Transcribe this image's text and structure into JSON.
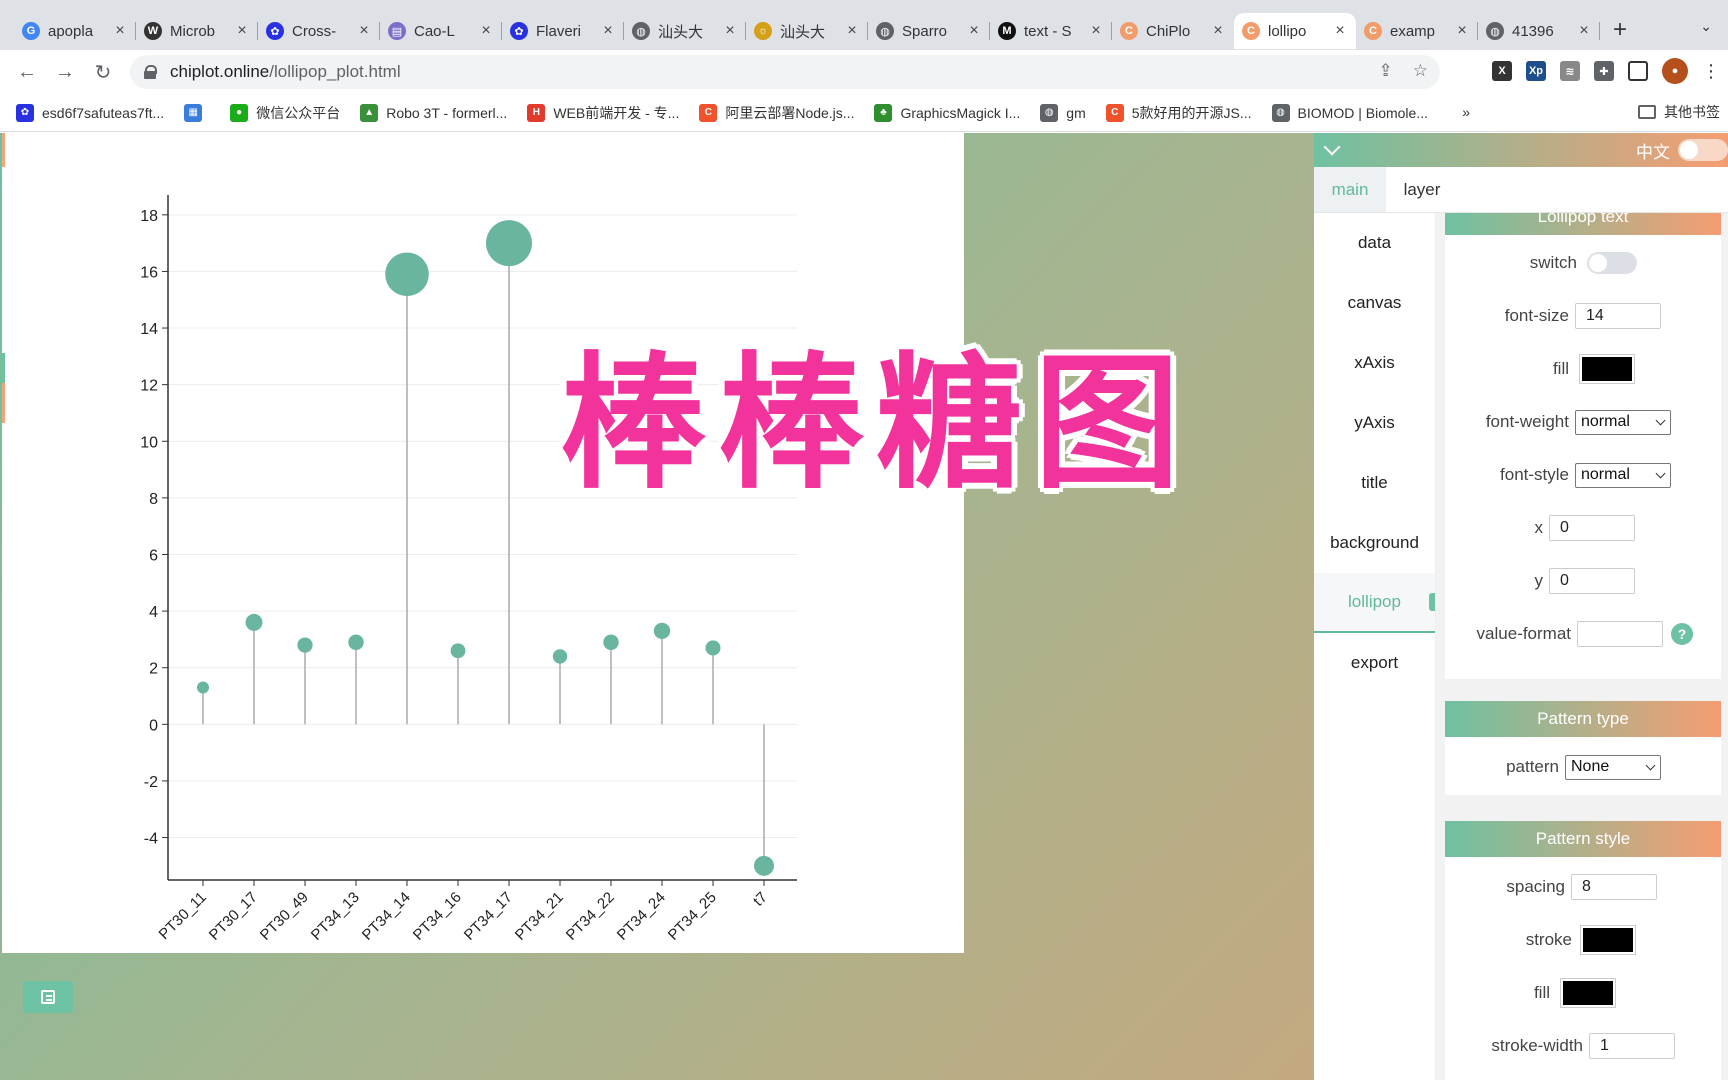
{
  "browser": {
    "tabs": [
      {
        "title": "apopla",
        "favicon": "google-icon",
        "color": "#4285f4",
        "glyph": "G"
      },
      {
        "title": "Microb",
        "favicon": "wikipedia-icon",
        "color": "#333333",
        "glyph": "W"
      },
      {
        "title": "Cross-",
        "favicon": "baidu-icon",
        "color": "#2932e1",
        "glyph": "✿"
      },
      {
        "title": "Cao-L",
        "favicon": "document-icon",
        "color": "#7a6fc9",
        "glyph": "▤"
      },
      {
        "title": "Flaveri",
        "favicon": "baidu-icon",
        "color": "#2932e1",
        "glyph": "✿"
      },
      {
        "title": "汕头大",
        "favicon": "globe-icon",
        "color": "#5f6368",
        "glyph": "◍"
      },
      {
        "title": "汕头大",
        "favicon": "university-icon",
        "color": "#d4a017",
        "glyph": "☼"
      },
      {
        "title": "Sparro",
        "favicon": "globe-icon",
        "color": "#5f6368",
        "glyph": "◍"
      },
      {
        "title": "text - S",
        "favicon": "m-icon",
        "color": "#111111",
        "glyph": "M"
      },
      {
        "title": "ChiPlo",
        "favicon": "chiplot-icon",
        "color": "#f39c6b",
        "glyph": "C"
      },
      {
        "title": "lollipo",
        "favicon": "chiplot-icon",
        "color": "#f39c6b",
        "glyph": "C"
      },
      {
        "title": "examp",
        "favicon": "chiplot-icon",
        "color": "#f39c6b",
        "glyph": "C"
      },
      {
        "title": "41396",
        "favicon": "globe-icon",
        "color": "#5f6368",
        "glyph": "◍"
      }
    ],
    "active_tab": 10,
    "url_host": "chiplot.online",
    "url_path": "/lollipop_plot.html",
    "bookmarks": [
      {
        "label": "esd6f7safuteas7ft...",
        "color": "#2932e1",
        "glyph": "✿"
      },
      {
        "label": "",
        "color": "#3b7ddd",
        "glyph": "▦"
      },
      {
        "label": "微信公众平台",
        "color": "#1aad19",
        "glyph": "●"
      },
      {
        "label": "Robo 3T - formerl...",
        "color": "#3a8f3a",
        "glyph": "▲"
      },
      {
        "label": "WEB前端开发 - 专...",
        "color": "#e23b2e",
        "glyph": "H"
      },
      {
        "label": "阿里云部署Node.js...",
        "color": "#f0522c",
        "glyph": "C"
      },
      {
        "label": "GraphicsMagick I...",
        "color": "#2f8f2f",
        "glyph": "♣"
      },
      {
        "label": "gm",
        "color": "#5f6368",
        "glyph": "◍"
      },
      {
        "label": "5款好用的开源JS...",
        "color": "#f0522c",
        "glyph": "C"
      },
      {
        "label": "BIOMOD | Biomole...",
        "color": "#5f6368",
        "glyph": "◍"
      }
    ],
    "more_bookmarks": "»",
    "other_bookmarks": "其他书签"
  },
  "overlay_title": "棒棒糖图",
  "chart_data": {
    "type": "lollipop",
    "categories": [
      "PT30_11",
      "PT30_17",
      "PT30_49",
      "PT34_13",
      "PT34_14",
      "PT34_16",
      "PT34_17",
      "PT34_21",
      "PT34_22",
      "PT34_24",
      "PT34_25",
      "t7"
    ],
    "values": [
      1.3,
      3.6,
      2.8,
      2.9,
      15.9,
      2.6,
      17.0,
      2.4,
      2.9,
      3.3,
      2.7,
      -5.0
    ],
    "y_ticks": [
      -4,
      -2,
      0,
      2,
      4,
      6,
      8,
      10,
      12,
      14,
      16,
      18
    ],
    "ylim": [
      -5.5,
      18.7
    ],
    "point_color": "#6ab5a0",
    "stem_color": "#aaaaaa",
    "grid": true
  },
  "panel": {
    "lang_label": "中文",
    "tabs": [
      "main",
      "layer"
    ],
    "active_tab": 0,
    "nav": [
      "data",
      "canvas",
      "xAxis",
      "yAxis",
      "title",
      "background",
      "lollipop",
      "export"
    ],
    "active_nav": 6,
    "sections": {
      "lollipop_text": {
        "title": "Lollipop text",
        "switch_label": "switch",
        "font_size_label": "font-size",
        "font_size": "14",
        "fill_label": "fill",
        "fill_color": "#000000",
        "font_weight_label": "font-weight",
        "font_weight": "normal",
        "font_style_label": "font-style",
        "font_style": "normal",
        "x_label": "x",
        "x": "0",
        "y_label": "y",
        "y": "0",
        "value_format_label": "value-format",
        "value_format": "",
        "help": "?"
      },
      "pattern_type": {
        "title": "Pattern type",
        "pattern_label": "pattern",
        "pattern": "None"
      },
      "pattern_style": {
        "title": "Pattern style",
        "spacing_label": "spacing",
        "spacing": "8",
        "stroke_label": "stroke",
        "stroke_color": "#000000",
        "fill_label": "fill",
        "fill_color": "#000000",
        "stroke_width_label": "stroke-width",
        "stroke_width": "1"
      }
    }
  }
}
